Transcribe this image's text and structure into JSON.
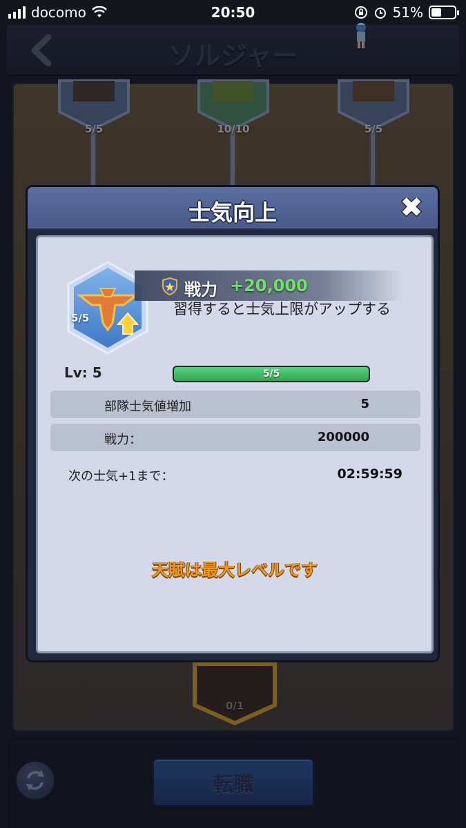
{
  "status_bar": {
    "carrier": "docomo",
    "time": "20:50",
    "battery": "51%"
  },
  "header": {
    "title": "ソルジャー"
  },
  "tree": {
    "nodes": [
      "5/5",
      "10/10",
      "5/5",
      "0/1"
    ]
  },
  "modal": {
    "title": "士気向上",
    "close": "✖",
    "skill": {
      "level_badge": "5/5",
      "power_label": "戦力",
      "power_value": "+20,000",
      "description": "習得すると士気上限がアップする",
      "icon": "eagle-emblem-icon"
    },
    "lv_label": "Lv: 5",
    "progress": {
      "text": "5/5",
      "fraction": 1.0
    },
    "stats": [
      {
        "label": "部隊士気値増加",
        "value": "5"
      },
      {
        "label": "戦力：",
        "value": "200000"
      }
    ],
    "next_label": "次の士気+1まで：",
    "next_timer": "02:59:59",
    "max_message": "天賦は最大レベルです"
  },
  "bottom": {
    "change_job_label": "転職"
  },
  "colors": {
    "accent_green": "#6fe06a",
    "max_orange": "#f09a1c",
    "modal_header": "#5b6ea0"
  }
}
